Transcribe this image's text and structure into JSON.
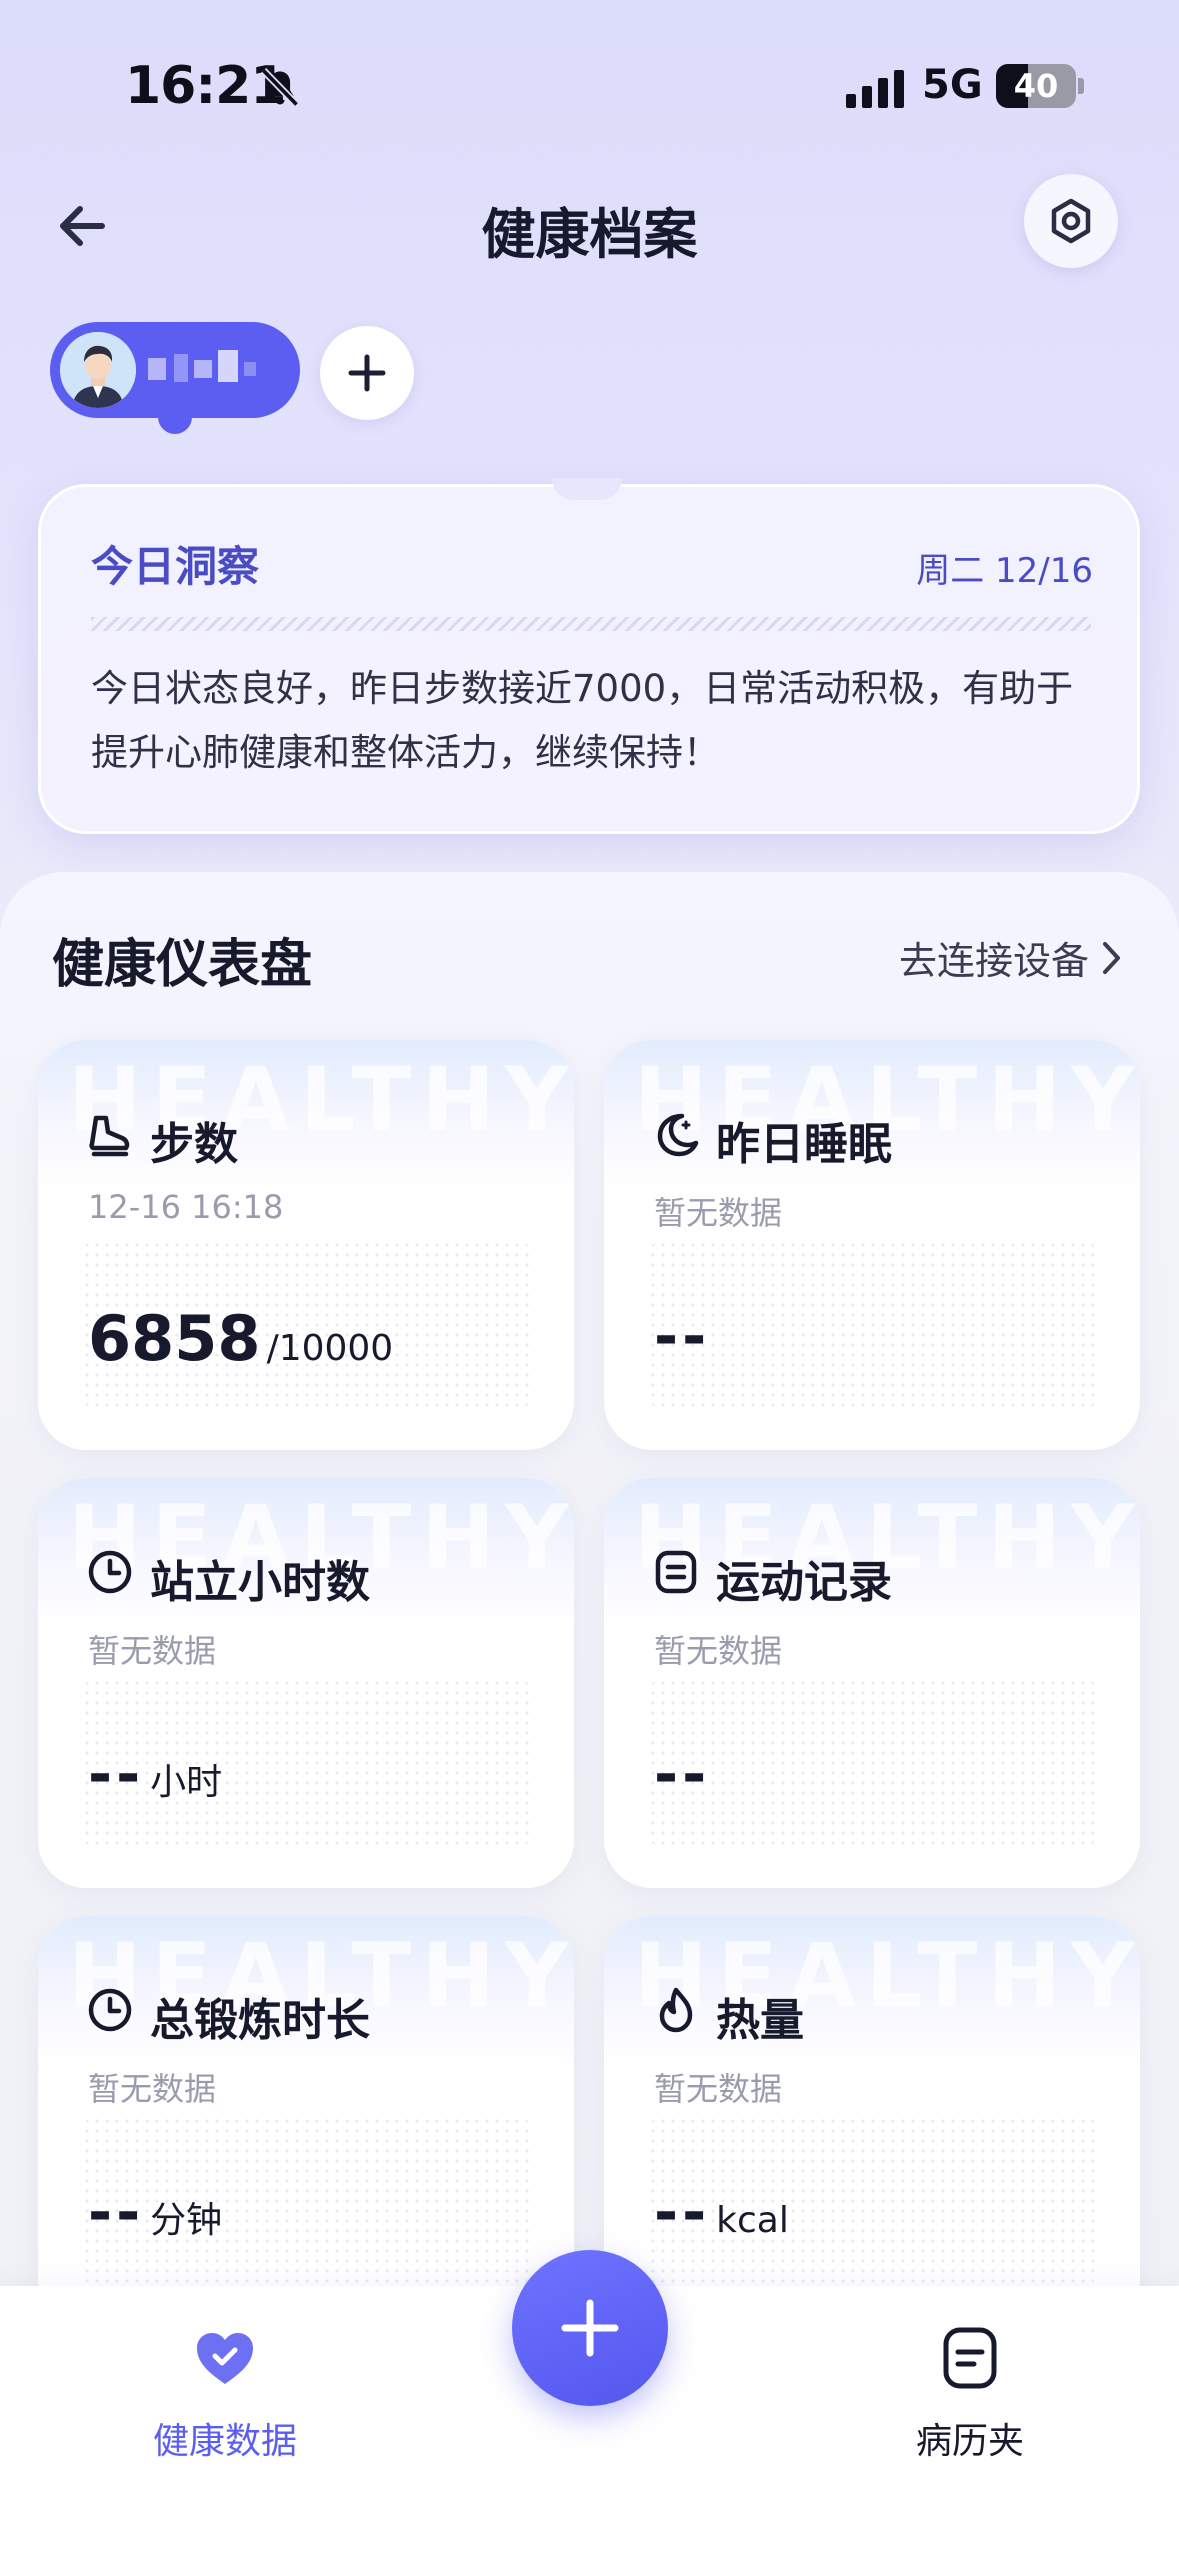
{
  "status_bar": {
    "time": "16:21",
    "network": "5G",
    "battery": "40",
    "battery_level": 0.4
  },
  "header": {
    "title": "健康档案"
  },
  "insight": {
    "title": "今日洞察",
    "date": "周二 12/16",
    "text": "今日状态良好，昨日步数接近7000，日常活动积极，有助于提升心肺健康和整体活力，继续保持！"
  },
  "dashboard": {
    "title": "健康仪表盘",
    "connect_link": "去连接设备",
    "watermark": "HEALTHY",
    "cards": [
      {
        "icon": "shoe-icon",
        "title": "步数",
        "subtitle": "12-16 16:18",
        "value": "6858",
        "unit": "/10000"
      },
      {
        "icon": "moon-icon",
        "title": "昨日睡眠",
        "subtitle": "暂无数据",
        "value": "--",
        "unit": ""
      },
      {
        "icon": "clock-icon",
        "title": "站立小时数",
        "subtitle": "暂无数据",
        "value": "--",
        "unit": "小时"
      },
      {
        "icon": "list-icon",
        "title": "运动记录",
        "subtitle": "暂无数据",
        "value": "--",
        "unit": ""
      },
      {
        "icon": "clock-icon",
        "title": "总锻炼时长",
        "subtitle": "暂无数据",
        "value": "--",
        "unit": "分钟"
      },
      {
        "icon": "flame-icon",
        "title": "热量",
        "subtitle": "暂无数据",
        "value": "--",
        "unit": "kcal"
      }
    ]
  },
  "tab_bar": {
    "health_data": "健康数据",
    "records": "病历夹"
  },
  "colors": {
    "accent": "#5b5ef1",
    "text": "#17192c",
    "muted": "#9a9cad"
  }
}
